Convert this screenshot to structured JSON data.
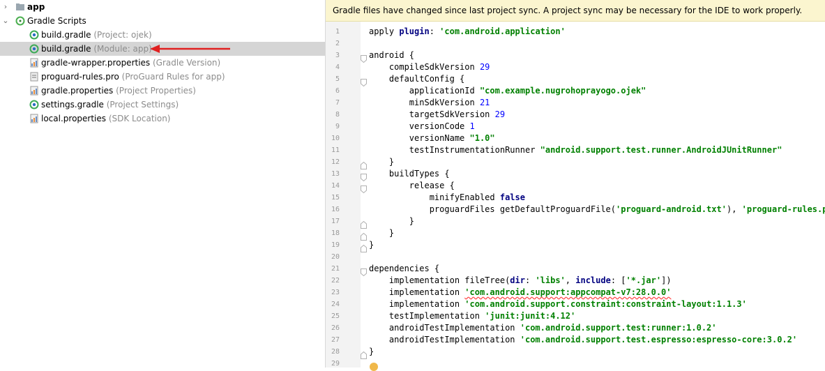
{
  "project_tree": [
    {
      "name": "app",
      "hint": "",
      "icon": "folder-icon",
      "chevron": "right",
      "level": 0,
      "bold": true
    },
    {
      "name": "Gradle Scripts",
      "hint": "",
      "icon": "gradle-scripts-icon",
      "chevron": "down",
      "level": 0,
      "bold": false
    },
    {
      "name": "build.gradle",
      "hint": "(Project: ojek)",
      "icon": "gradle-icon",
      "level": 1
    },
    {
      "name": "build.gradle",
      "hint": "(Module: app)",
      "icon": "gradle-icon",
      "level": 1,
      "selected": true
    },
    {
      "name": "gradle-wrapper.properties",
      "hint": "(Gradle Version)",
      "icon": "properties-icon",
      "level": 1
    },
    {
      "name": "proguard-rules.pro",
      "hint": "(ProGuard Rules for app)",
      "icon": "proguard-icon",
      "level": 1
    },
    {
      "name": "gradle.properties",
      "hint": "(Project Properties)",
      "icon": "properties-icon",
      "level": 1
    },
    {
      "name": "settings.gradle",
      "hint": "(Project Settings)",
      "icon": "gradle-icon",
      "level": 1
    },
    {
      "name": "local.properties",
      "hint": "(SDK Location)",
      "icon": "properties-icon",
      "level": 1
    }
  ],
  "banner": {
    "text": "Gradle files have changed since last project sync. A project sync may be necessary for the IDE to work properly."
  },
  "colors": {
    "accent_arrow": "#e02020",
    "banner_bg": "#fbf5cf",
    "selection_bg": "#d5d5d5",
    "keyword": "#000080",
    "string": "#008000",
    "number": "#0000ff"
  },
  "code": {
    "lines": [
      {
        "n": "1",
        "t": "apply plugin: 'com.android.application'"
      },
      {
        "n": "2",
        "t": ""
      },
      {
        "n": "3",
        "t": "android {",
        "fold": "open"
      },
      {
        "n": "4",
        "t": "    compileSdkVersion 29"
      },
      {
        "n": "5",
        "t": "    defaultConfig {",
        "fold": "open"
      },
      {
        "n": "6",
        "t": "        applicationId \"com.example.nugrohoprayogo.ojek\""
      },
      {
        "n": "7",
        "t": "        minSdkVersion 21"
      },
      {
        "n": "8",
        "t": "        targetSdkVersion 29"
      },
      {
        "n": "9",
        "t": "        versionCode 1"
      },
      {
        "n": "10",
        "t": "        versionName \"1.0\""
      },
      {
        "n": "11",
        "t": "        testInstrumentationRunner \"android.support.test.runner.AndroidJUnitRunner\""
      },
      {
        "n": "12",
        "t": "    }",
        "fold": "close"
      },
      {
        "n": "13",
        "t": "    buildTypes {",
        "fold": "open"
      },
      {
        "n": "14",
        "t": "        release {",
        "fold": "open"
      },
      {
        "n": "15",
        "t": "            minifyEnabled false"
      },
      {
        "n": "16",
        "t": "            proguardFiles getDefaultProguardFile('proguard-android.txt'), 'proguard-rules.pro'"
      },
      {
        "n": "17",
        "t": "        }",
        "fold": "close"
      },
      {
        "n": "18",
        "t": "    }",
        "fold": "close"
      },
      {
        "n": "19",
        "t": "}",
        "fold": "close"
      },
      {
        "n": "20",
        "t": ""
      },
      {
        "n": "21",
        "t": "dependencies {",
        "fold": "open"
      },
      {
        "n": "22",
        "t": "    implementation fileTree(dir: 'libs', include: ['*.jar'])"
      },
      {
        "n": "23",
        "t": "    implementation 'com.android.support:appcompat-v7:28.0.0'",
        "warn": true
      },
      {
        "n": "24",
        "t": "    implementation 'com.android.support.constraint:constraint-layout:1.1.3'"
      },
      {
        "n": "25",
        "t": "    testImplementation 'junit:junit:4.12'"
      },
      {
        "n": "26",
        "t": "    androidTestImplementation 'com.android.support.test:runner:1.0.2'"
      },
      {
        "n": "27",
        "t": "    androidTestImplementation 'com.android.support.test.espresso:espresso-core:3.0.2'"
      },
      {
        "n": "28",
        "t": "}",
        "fold": "close"
      },
      {
        "n": "29",
        "t": ""
      }
    ]
  }
}
